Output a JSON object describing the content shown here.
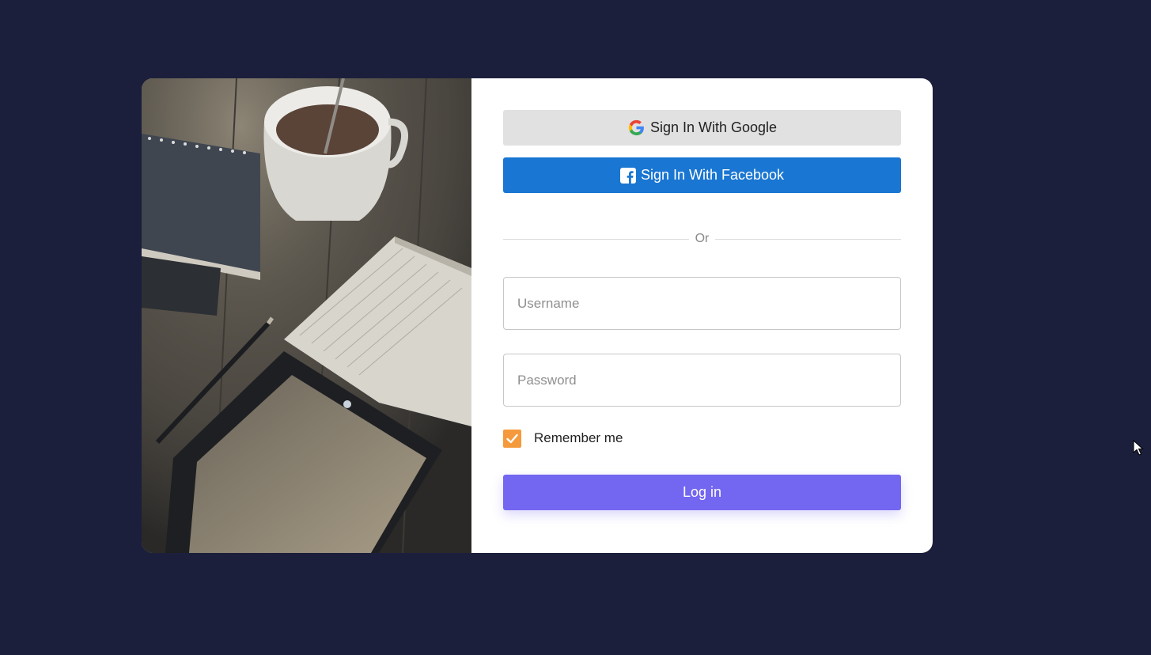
{
  "auth": {
    "google_label": "Sign In With Google",
    "facebook_label": "Sign In With Facebook",
    "divider_text": "Or",
    "username_placeholder": "Username",
    "password_placeholder": "Password",
    "remember_label": "Remember me",
    "remember_checked": true,
    "login_label": "Log in"
  },
  "colors": {
    "background": "#1c1f3b",
    "google_button": "#e1e1e1",
    "facebook_button": "#1976d2",
    "login_button": "#7366f0",
    "checkbox": "#f59a3c"
  },
  "icons": {
    "google": "google-g-icon",
    "facebook": "facebook-f-icon",
    "checkmark": "check-icon",
    "cursor": "mouse-pointer-icon"
  }
}
